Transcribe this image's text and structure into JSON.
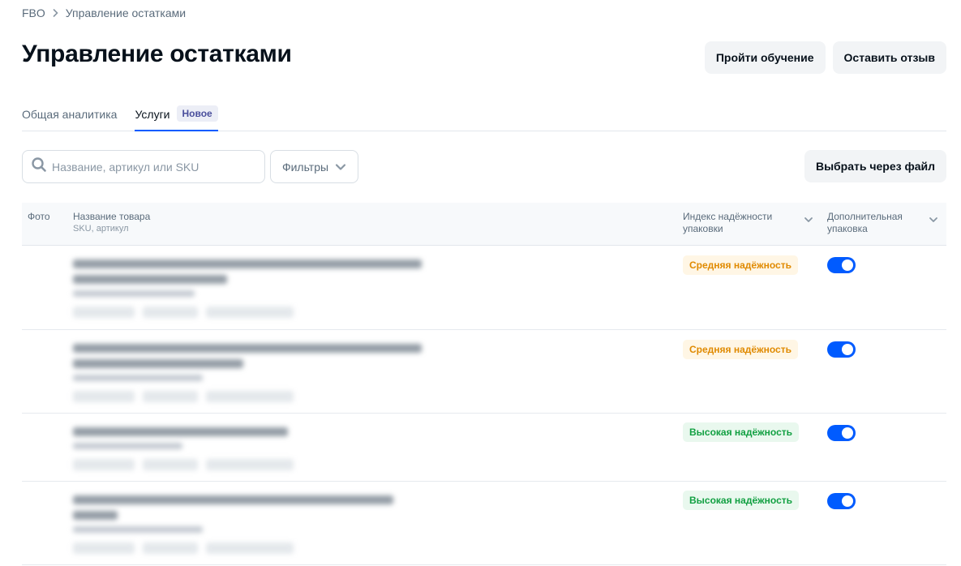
{
  "breadcrumb": {
    "root": "FBO",
    "current": "Управление остатками"
  },
  "page_title": "Управление остатками",
  "header_buttons": {
    "training": "Пройти обучение",
    "feedback": "Оставить отзыв"
  },
  "tabs": [
    {
      "label": "Общая аналитика",
      "active": false
    },
    {
      "label": "Услуги",
      "active": true,
      "badge": "Новое"
    }
  ],
  "toolbar": {
    "search_placeholder": "Название, артикул или SKU",
    "filters_label": "Фильтры",
    "file_button": "Выбрать через файл"
  },
  "table": {
    "columns": {
      "photo": "Фото",
      "name": "Название товара",
      "name_sub": "SKU, артикул",
      "reliability_line1": "Индекс надёжности",
      "reliability_line2": "упаковки",
      "packaging_line1": "Дополнительная",
      "packaging_line2": "упаковка"
    },
    "rows": [
      {
        "reliability": "Средняя надёжность",
        "level": "medium",
        "extra_packaging": true
      },
      {
        "reliability": "Средняя надёжность",
        "level": "medium",
        "extra_packaging": true
      },
      {
        "reliability": "Высокая надёжность",
        "level": "high",
        "extra_packaging": true
      },
      {
        "reliability": "Высокая надёжность",
        "level": "high",
        "extra_packaging": true
      }
    ]
  },
  "colors": {
    "accent": "#005bff",
    "medium_text": "#e08a00",
    "medium_bg": "#fff6e5",
    "high_text": "#12a042",
    "high_bg": "#e9f8ee"
  }
}
